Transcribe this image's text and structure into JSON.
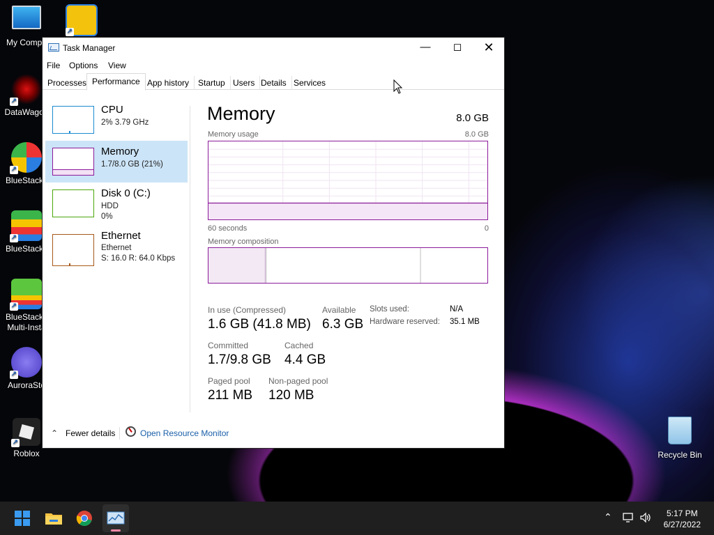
{
  "desktop": {
    "icons": [
      {
        "label": "My Compu"
      },
      {
        "label": "DataWagon"
      },
      {
        "label": "BlueStacks"
      },
      {
        "label": "BlueStacks"
      },
      {
        "label": "BlueStacks Multi-Insta"
      },
      {
        "label": "AuroraSto"
      },
      {
        "label": "Roblox"
      },
      {
        "label": "Recycle Bin"
      }
    ]
  },
  "window": {
    "title": "Task Manager",
    "menu": [
      "File",
      "Options",
      "View"
    ],
    "tabs": [
      "Processes",
      "Performance",
      "App history",
      "Startup",
      "Users",
      "Details",
      "Services"
    ],
    "active_tab": "Performance"
  },
  "left_list": [
    {
      "name": "CPU",
      "line1": "2%  3.79 GHz",
      "line2": "",
      "color": "#1a8ad0"
    },
    {
      "name": "Memory",
      "line1": "1.7/8.0 GB (21%)",
      "line2": "",
      "color": "#8b1a9a"
    },
    {
      "name": "Disk 0 (C:)",
      "line1": "HDD",
      "line2": "0%",
      "color": "#4da60c"
    },
    {
      "name": "Ethernet",
      "line1": "Ethernet",
      "line2": "S: 16.0  R: 64.0 Kbps",
      "color": "#a7581a"
    }
  ],
  "memory": {
    "title": "Memory",
    "total": "8.0 GB",
    "usage_label": "Memory usage",
    "usage_max": "8.0 GB",
    "time_left": "60 seconds",
    "time_right": "0",
    "usage_fraction": 0.21,
    "composition_label": "Memory composition",
    "composition": {
      "in_use_gb": 1.6,
      "modified_gb": 0.02,
      "standby_gb": 4.4,
      "free_gb": 1.9
    },
    "stats": {
      "in_use_label": "In use (Compressed)",
      "in_use_value": "1.6 GB (41.8 MB)",
      "available_label": "Available",
      "available_value": "6.3 GB",
      "committed_label": "Committed",
      "committed_value": "1.7/9.8 GB",
      "cached_label": "Cached",
      "cached_value": "4.4 GB",
      "paged_label": "Paged pool",
      "paged_value": "211 MB",
      "nonpaged_label": "Non-paged pool",
      "nonpaged_value": "120 MB",
      "slots_label": "Slots used:",
      "slots_value": "N/A",
      "hwres_label": "Hardware reserved:",
      "hwres_value": "35.1 MB"
    }
  },
  "footer": {
    "fewer_details": "Fewer details",
    "open_resource_monitor": "Open Resource Monitor"
  },
  "taskbar": {
    "time": "5:17 PM",
    "date": "6/27/2022"
  }
}
